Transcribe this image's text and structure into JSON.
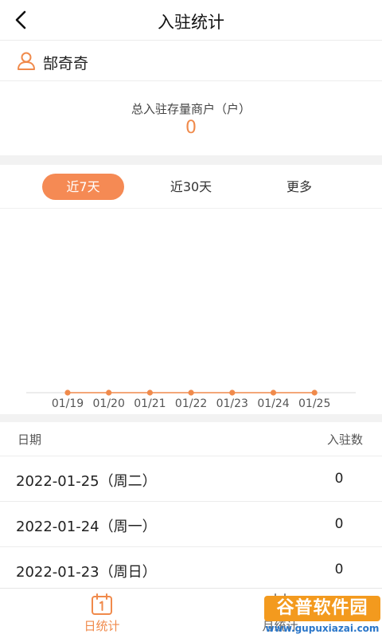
{
  "header": {
    "title": "入驻统计",
    "back_icon": "back-arrow-icon"
  },
  "user": {
    "name": "郜奇奇",
    "icon": "user-icon"
  },
  "summary": {
    "label": "总入驻存量商户（户）",
    "value": "0"
  },
  "tabs": [
    {
      "label": "近7天",
      "active": true
    },
    {
      "label": "近30天",
      "active": false
    },
    {
      "label": "更多",
      "active": false
    }
  ],
  "chart_data": {
    "type": "line",
    "categories": [
      "01/19",
      "01/20",
      "01/21",
      "01/22",
      "01/23",
      "01/24",
      "01/25"
    ],
    "values": [
      0,
      0,
      0,
      0,
      0,
      0,
      0
    ],
    "color": "#f08a4b",
    "grid": false
  },
  "table": {
    "headers": {
      "date": "日期",
      "count": "入驻数"
    },
    "rows": [
      {
        "date": "2022-01-25（周二）",
        "count": "0"
      },
      {
        "date": "2022-01-24（周一）",
        "count": "0"
      },
      {
        "date": "2022-01-23（周日）",
        "count": "0"
      }
    ]
  },
  "tabbar": {
    "items": [
      {
        "label": "日统计",
        "icon": "calendar-day-icon",
        "active": true
      },
      {
        "label": "月统计",
        "icon": "calendar-month-icon",
        "active": false
      }
    ]
  },
  "watermark": {
    "text": "谷普软件园",
    "url": "www.gupuxiazai.com"
  },
  "colors": {
    "accent": "#f58a54",
    "chart_line": "#f08a4b",
    "divider": "#f2f2f2"
  }
}
